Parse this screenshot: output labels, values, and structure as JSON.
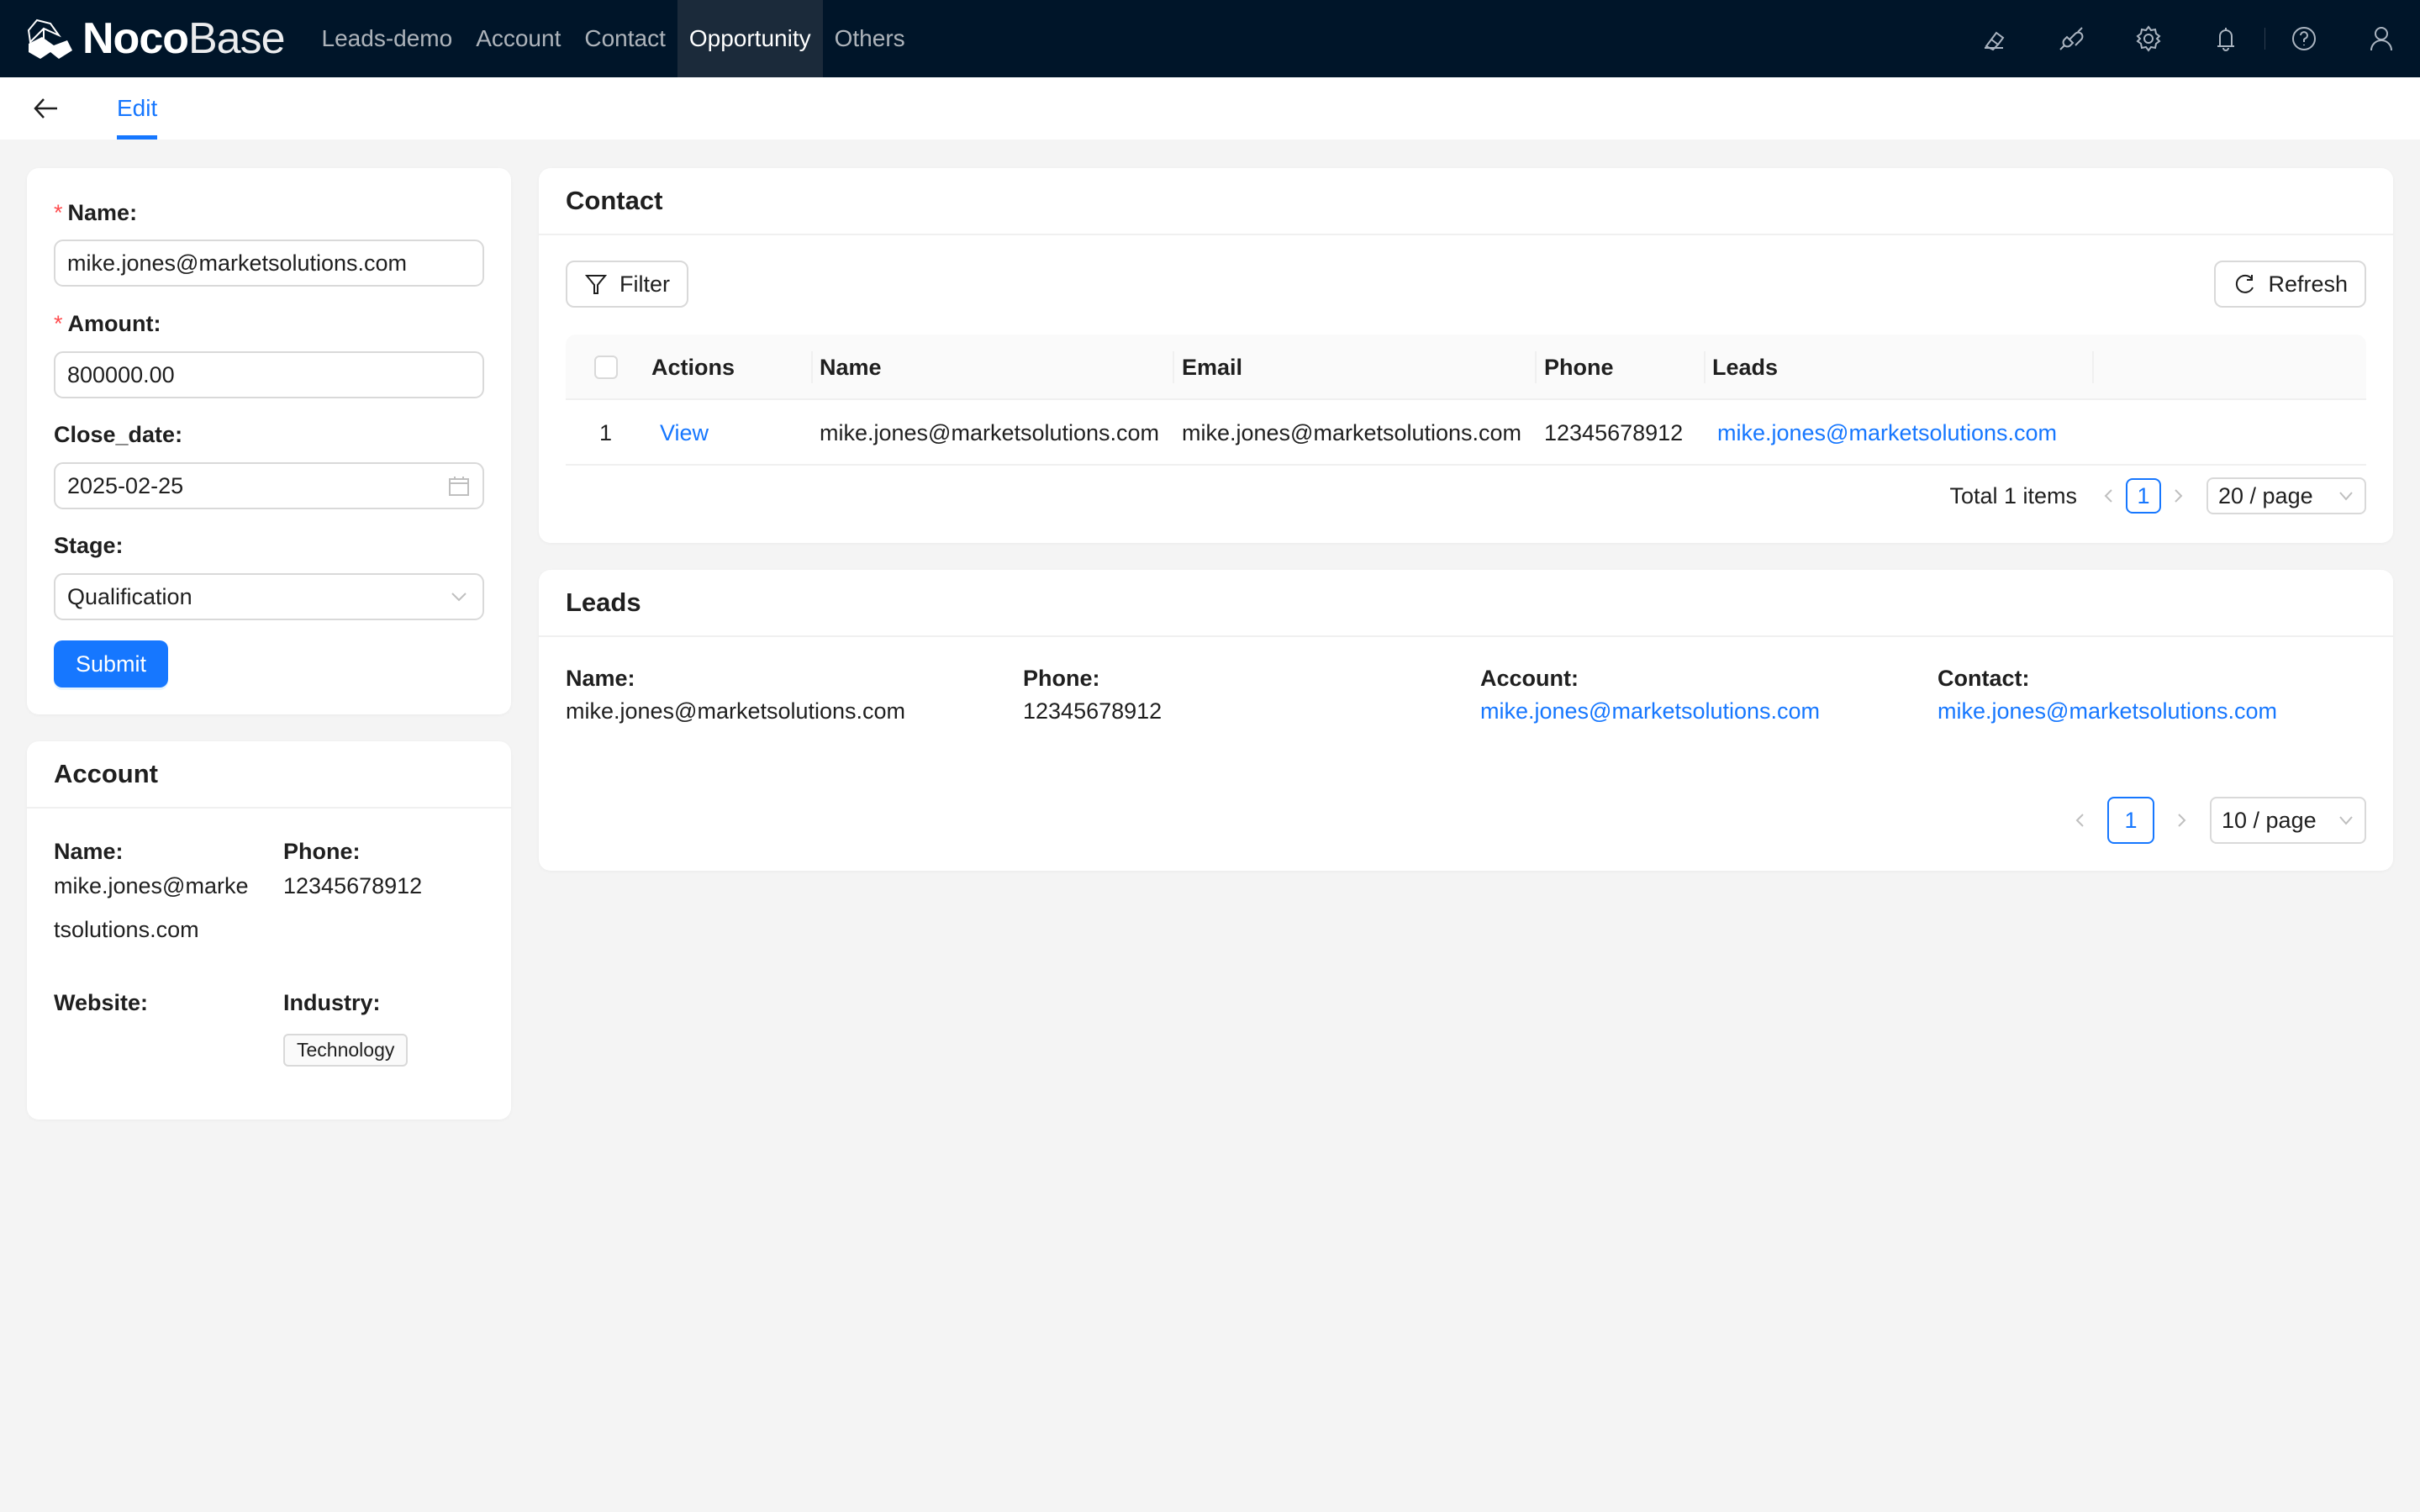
{
  "app": {
    "logo_bold": "Noco",
    "logo_light": "Base",
    "menu": [
      {
        "label": "Leads-demo",
        "active": false
      },
      {
        "label": "Account",
        "active": false
      },
      {
        "label": "Contact",
        "active": false
      },
      {
        "label": "Opportunity",
        "active": true
      },
      {
        "label": "Others",
        "active": false
      }
    ],
    "top_icons": [
      "theme-icon",
      "plugin-icon",
      "settings-icon",
      "bell-icon",
      "help-icon",
      "user-icon"
    ]
  },
  "subheader": {
    "back_icon": "arrow-left-icon",
    "tab": "Edit"
  },
  "form": {
    "name": {
      "label": "Name",
      "required": true,
      "value": "mike.jones@marketsolutions.com"
    },
    "amount": {
      "label": "Amount",
      "required": true,
      "value": "800000.00"
    },
    "close_date": {
      "label": "Close_date",
      "required": false,
      "value": "2025-02-25"
    },
    "stage": {
      "label": "Stage",
      "required": false,
      "value": "Qualification"
    },
    "submit_label": "Submit",
    "colon": ":"
  },
  "account": {
    "title": "Account",
    "fields": {
      "name": {
        "label": "Name:",
        "value_line1": "mike.jones@marke",
        "value_line2": "tsolutions.com"
      },
      "phone": {
        "label": "Phone:",
        "value": "12345678912"
      },
      "website": {
        "label": "Website:",
        "value": ""
      },
      "industry": {
        "label": "Industry:",
        "tag": "Technology"
      }
    }
  },
  "contact": {
    "title": "Contact",
    "filter_label": "Filter",
    "refresh_label": "Refresh",
    "columns": [
      "Actions",
      "Name",
      "Email",
      "Phone",
      "Leads"
    ],
    "rows": [
      {
        "index": "1",
        "action": "View",
        "name": "mike.jones@marketsolutions.com",
        "email": "mike.jones@marketsolutions.com",
        "phone": "12345678912",
        "leads": "mike.jones@marketsolutions.com"
      }
    ],
    "pagination": {
      "total": "Total 1 items",
      "current": "1",
      "page_size": "20 / page"
    }
  },
  "leads": {
    "title": "Leads",
    "fields": {
      "name": {
        "label": "Name:",
        "value": "mike.jones@marketsolutions.com"
      },
      "phone": {
        "label": "Phone:",
        "value": "12345678912"
      },
      "account": {
        "label": "Account:",
        "value": "mike.jones@marketsolutions.com"
      },
      "contact": {
        "label": "Contact:",
        "value": "mike.jones@marketsolutions.com"
      }
    },
    "pagination": {
      "current": "1",
      "page_size": "10 / page"
    }
  },
  "colors": {
    "nav_bg": "#001529",
    "primary": "#1677ff",
    "required": "#ff4d4f",
    "page_bg": "#f4f4f4"
  }
}
